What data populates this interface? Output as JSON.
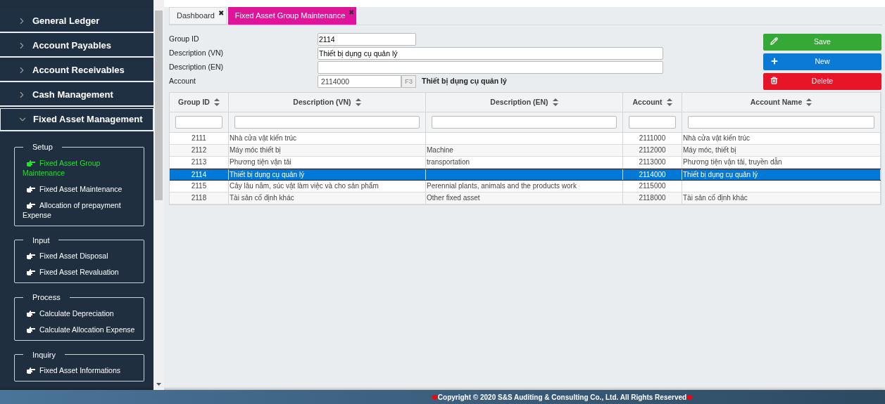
{
  "sidebar": {
    "modules": [
      {
        "label": "General Ledger",
        "expanded": false
      },
      {
        "label": "Account Payables",
        "expanded": false
      },
      {
        "label": "Account Receivables",
        "expanded": false
      },
      {
        "label": "Cash Management",
        "expanded": false
      },
      {
        "label": "Fixed Asset Management",
        "expanded": true,
        "groups": [
          {
            "title": "Setup",
            "items": [
              {
                "label": "Fixed Asset Group Maintenance",
                "selected": true
              },
              {
                "label": "Fixed Asset Maintenance",
                "selected": false
              },
              {
                "label": "Allocation of prepayment Expense",
                "selected": false
              }
            ]
          },
          {
            "title": "Input",
            "items": [
              {
                "label": "Fixed Asset Disposal",
                "selected": false
              },
              {
                "label": "Fixed Asset Revaluation",
                "selected": false
              }
            ]
          },
          {
            "title": "Process",
            "items": [
              {
                "label": "Calculate Depreciation",
                "selected": false
              },
              {
                "label": "Calculate Allocation Expense",
                "selected": false
              }
            ]
          },
          {
            "title": "Inquiry",
            "items": [
              {
                "label": "Fixed Asset Informations",
                "selected": false
              }
            ]
          }
        ]
      }
    ]
  },
  "tabs": [
    {
      "label": "Dashboard",
      "selected": false,
      "close": "✖"
    },
    {
      "label": "Fixed Asset Group Maintenance",
      "selected": true,
      "close": "✖"
    }
  ],
  "form": {
    "fields": [
      {
        "label": "Group ID",
        "value": "2114",
        "kind": "short"
      },
      {
        "label": "Description (VN)",
        "value": "Thiết bị dụng cụ quản lý",
        "kind": "long"
      },
      {
        "label": "Description (EN)",
        "kind": "long"
      },
      {
        "label": "Account",
        "value": "2114000",
        "kind": "lookup",
        "key": "F3",
        "lookup_name": "Thiết bị dụng cụ quản lý"
      }
    ],
    "buttons": [
      {
        "label": "Save",
        "kind": "save"
      },
      {
        "label": "New",
        "kind": "new"
      },
      {
        "label": "Delete",
        "kind": "delete"
      }
    ]
  },
  "table": {
    "columns": [
      "Group ID",
      "Description (VN)",
      "Description (EN)",
      "Account",
      "Account Name"
    ],
    "rows": [
      {
        "cells": [
          "2111",
          "Nhà cửa vật kiến trúc",
          "",
          "2111000",
          "Nhà cửa vật kiến trúc"
        ],
        "selected": false
      },
      {
        "cells": [
          "2112",
          "Máy móc thiết bị",
          "Machine",
          "2112000",
          "Máy móc, thiết bị"
        ],
        "selected": false
      },
      {
        "cells": [
          "2113",
          "Phương tiện vận tải",
          "transportation",
          "2113000",
          "Phương tiện vận tải, truyền dẫn"
        ],
        "selected": false
      },
      {
        "cells": [
          "2114",
          "Thiết bị dụng cụ quản lý",
          "",
          "2114000",
          "Thiết bị dụng cụ quản lý"
        ],
        "selected": true
      },
      {
        "cells": [
          "2115",
          "Cây lâu năm, súc vật làm việc và cho sản phẩm",
          "Perennial plants, animals and the products work",
          "2115000",
          ""
        ],
        "selected": false
      },
      {
        "cells": [
          "2118",
          "Tài sản cố định khác",
          "Other fixed asset",
          "2118000",
          "Tài sản cố định khác"
        ],
        "selected": false
      }
    ]
  },
  "footer": {
    "text": "Copyright © 2020 S&S Auditing & Consulting Co., Ltd. All Rights Reserved"
  }
}
